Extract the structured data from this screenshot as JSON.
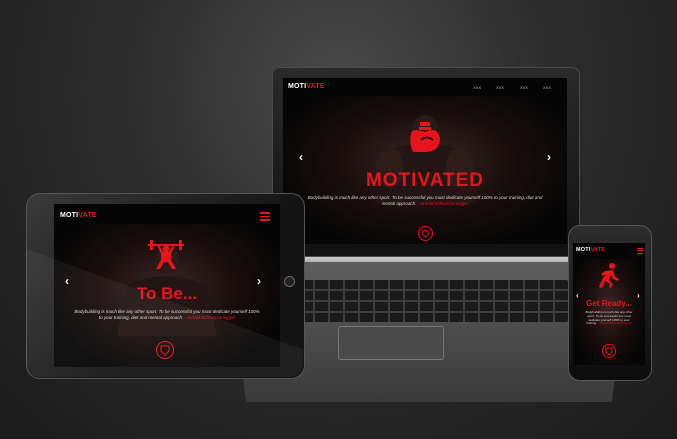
{
  "brand": {
    "logo_white": "MOTI",
    "logo_red": "VATE"
  },
  "laptop": {
    "nav": [
      "XXX",
      "XXX",
      "XXX",
      "XXX"
    ],
    "headline": "MOTIVATED",
    "quote": "Bodybuilding is much like any other sport. To be successful you must dedicate yourself 100% to your training, diet and mental approach.",
    "quote_link": "- Arnold Schwarzenegger",
    "arrow_left": "‹",
    "arrow_right": "›"
  },
  "tablet": {
    "headline": "To Be...",
    "quote": "Bodybuilding is much like any other sport. To be successful you must dedicate yourself 100% to your training, diet and mental approach.",
    "quote_link": "- Arnold Schwarzenegger",
    "arrow_left": "‹",
    "arrow_right": "›"
  },
  "phone": {
    "headline": "Get Ready...",
    "quote": "Bodybuilding is much like any other sport. To be successful you must dedicate yourself 100% to your training.",
    "quote_link": "- Arnold Schwarzenegger",
    "arrow_left": "‹",
    "arrow_right": "›"
  },
  "icons": {
    "laptop_hero": "flexed-bicep-icon",
    "tablet_hero": "weightlifter-icon",
    "phone_hero": "runner-icon",
    "emblem": "shield-emblem-icon",
    "menu": "hamburger-menu-icon"
  },
  "colors": {
    "accent": "#e8141c",
    "background": "#2c2c2c",
    "screen": "#050505"
  }
}
